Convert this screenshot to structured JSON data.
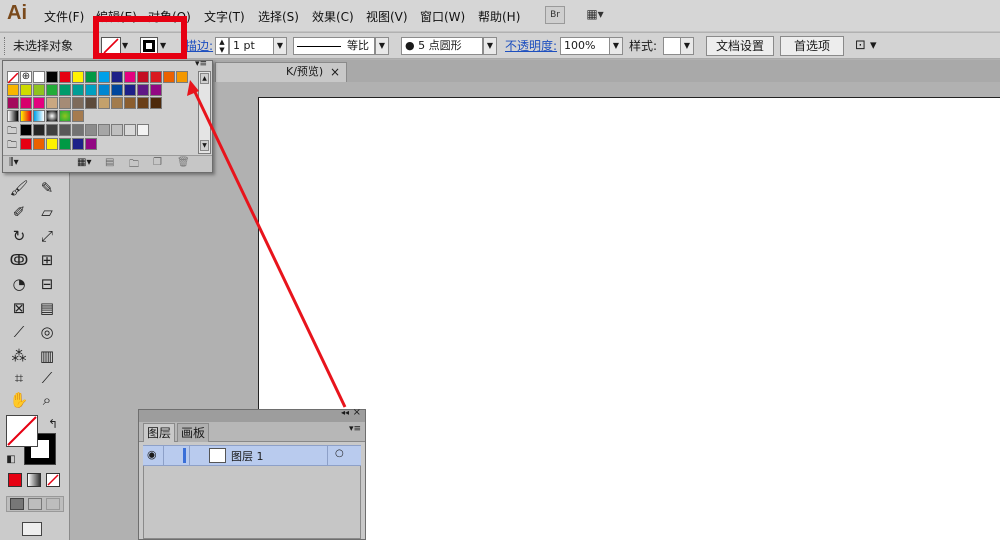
{
  "app": {
    "logo": "Ai"
  },
  "menu": [
    "文件(F)",
    "编辑(E)",
    "对象(O)",
    "文字(T)",
    "选择(S)",
    "效果(C)",
    "视图(V)",
    "窗口(W)",
    "帮助(H)"
  ],
  "app_buttons": {
    "bridge": "Br",
    "arrange": "▦▾"
  },
  "control_bar": {
    "selection_label": "未选择对象",
    "stroke_label": "描边:",
    "stroke_weight": "1 pt",
    "stroke_profile": "等比",
    "brush": "● 5 点圆形",
    "opacity_label": "不透明度:",
    "opacity_value": "100%",
    "style_label": "样式:",
    "doc_setup_button": "文档设置",
    "prefs_button": "首选项"
  },
  "document_tab": {
    "title": "K/预览)",
    "close": "×"
  },
  "swatches": {
    "row1": [
      "#ffffff",
      "#000000",
      "#e60012",
      "#fff100",
      "#009944",
      "#00a0e9",
      "#1d2088",
      "#e4007f",
      "#c30d23",
      "#d9191f",
      "#eb6100",
      "#f39800"
    ],
    "row2": [
      "#f8b500",
      "#cfdb00",
      "#8fc31f",
      "#22ac38",
      "#009b6b",
      "#009e96",
      "#00a0c1",
      "#0086d1",
      "#00479d",
      "#1d2088",
      "#601986",
      "#920783"
    ],
    "row3": [
      "#a40b5d",
      "#d7006c",
      "#e4007f",
      "#c9a882",
      "#a58b76",
      "#7d6b5b",
      "#5c4b3c",
      "#c3a16c",
      "#a27c4d",
      "#8b5e2f",
      "#6a3f18",
      "#4d2a0c"
    ],
    "gray_row": [
      "#000000",
      "#262626",
      "#404040",
      "#595959",
      "#737373",
      "#8c8c8c",
      "#a6a6a6",
      "#bfbfbf",
      "#d9d9d9",
      "#f2f2f2"
    ],
    "folder_row": [
      "#e60012",
      "#eb6100",
      "#fff100",
      "#009944",
      "#1d2088",
      "#920783"
    ]
  },
  "layers_panel": {
    "tab_layers": "图层",
    "tab_artboards": "画板",
    "layer_name": "图层 1",
    "collapse_icon": "◂◂",
    "close_icon": "×",
    "menu_icon": "▾≡"
  },
  "colors": {
    "highlight": "#e60012",
    "arrow": "#e8141c",
    "layer_selected": "#b9cbee",
    "logo": "#7a4a1c"
  }
}
